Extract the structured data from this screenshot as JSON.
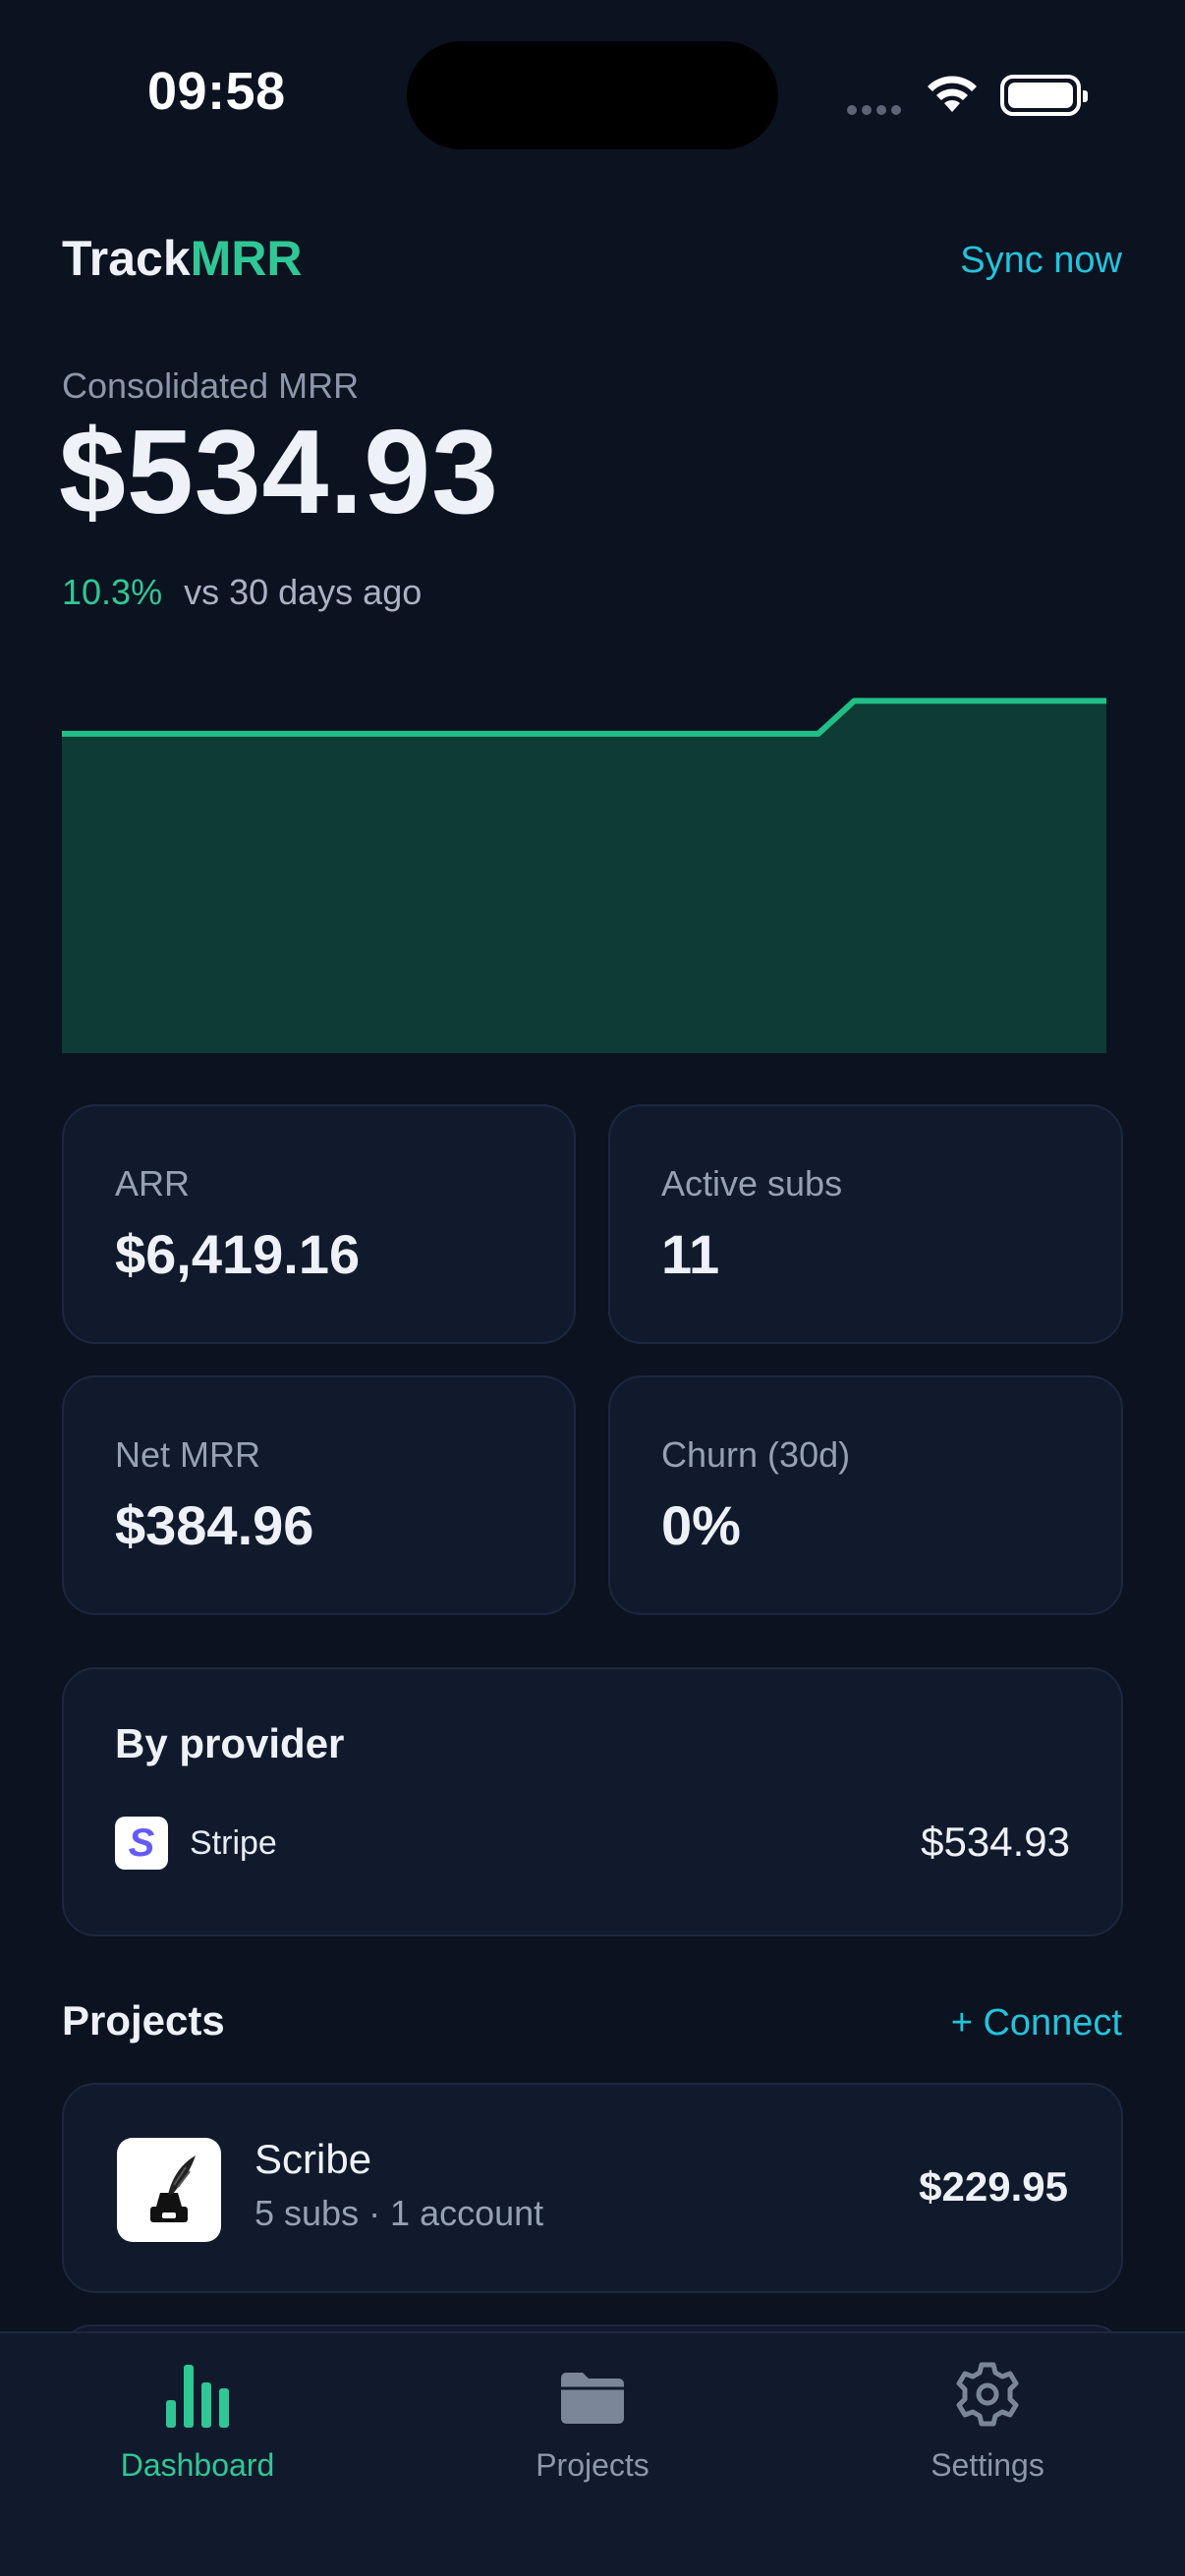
{
  "status_bar": {
    "time": "09:58"
  },
  "header": {
    "brand_part1": "Track",
    "brand_part2": "MRR",
    "sync_label": "Sync now"
  },
  "summary": {
    "label": "Consolidated MRR",
    "value": "$534.93",
    "change_pct": "10.3%",
    "change_label": "vs 30 days ago"
  },
  "chart_data": {
    "type": "area",
    "title": "",
    "xlabel": "",
    "ylabel": "",
    "series": [
      {
        "values": [
          485,
          485,
          485,
          485,
          485,
          485,
          485,
          485,
          485,
          485,
          485,
          485,
          485,
          485,
          485,
          485,
          485,
          485,
          485,
          485,
          485,
          485,
          534.93,
          534.93,
          534.93,
          534.93,
          534.93,
          534.93,
          534.93,
          534.93
        ]
      }
    ],
    "ylim": [
      0,
      540
    ],
    "grid": false,
    "colors": {
      "line": "#1fbf86",
      "fill": "#0f3b35"
    }
  },
  "stats": [
    {
      "label": "ARR",
      "value": "$6,419.16"
    },
    {
      "label": "Active subs",
      "value": "11"
    },
    {
      "label": "Net MRR",
      "value": "$384.96"
    },
    {
      "label": "Churn (30d)",
      "value": "0%"
    }
  ],
  "providers": {
    "title": "By provider",
    "items": [
      {
        "name": "Stripe",
        "value": "$534.93",
        "icon": "stripe-logo",
        "logo_letter": "S"
      }
    ]
  },
  "projects": {
    "title": "Projects",
    "connect_label": "+ Connect",
    "items": [
      {
        "name": "Scribe",
        "meta": "5 subs · 1 account",
        "value": "$229.95",
        "icon": "ink-quill-icon"
      }
    ]
  },
  "tabs": [
    {
      "label": "Dashboard",
      "icon": "bar-chart-icon",
      "active": true
    },
    {
      "label": "Projects",
      "icon": "folder-icon",
      "active": false
    },
    {
      "label": "Settings",
      "icon": "gear-icon",
      "active": false
    }
  ],
  "colors": {
    "background": "#0b1220",
    "card": "#111a2d",
    "accent_green": "#2fc894",
    "accent_cyan": "#22c4dc"
  }
}
